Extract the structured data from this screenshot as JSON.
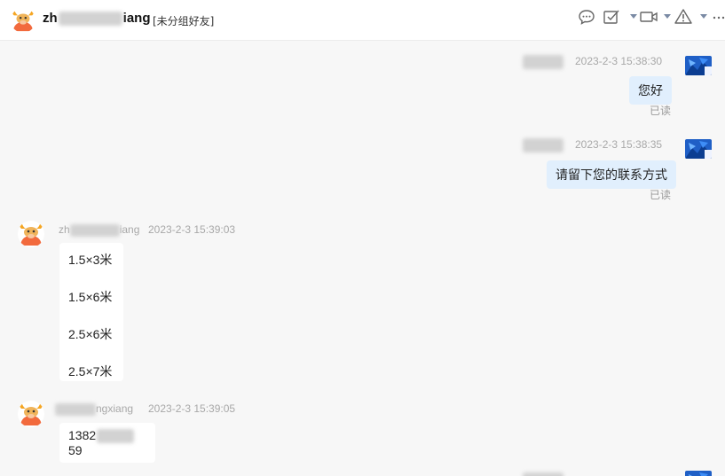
{
  "header": {
    "contact_name_prefix": "zh",
    "contact_name_suffix": "iang",
    "contact_tag": "[未分组好友]"
  },
  "toolbar": {
    "icons": [
      "chat-bubble-icon",
      "task-check-icon",
      "video-camera-icon",
      "warning-icon",
      "more-icon"
    ]
  },
  "messages": [
    {
      "sender_hidden": true,
      "time": "2023-2-3 15:38:30",
      "text": "您好",
      "status": "已读"
    },
    {
      "sender_hidden": true,
      "time": "2023-2-3 15:38:35",
      "text": "请留下您的联系方式",
      "status": "已读"
    },
    {
      "sender_prefix": "zh",
      "sender_suffix": "iang",
      "time": "2023-2-3 15:39:03",
      "lines": [
        "1.5×3米",
        "1.5×6米",
        "2.5×6米",
        "2.5×7米"
      ]
    },
    {
      "sender_suffix": "ngxiang",
      "time": "2023-2-3 15:39:05",
      "text_prefix": "1382",
      "text_suffix": "59"
    }
  ],
  "colors": {
    "my_bubble": "#e1effd",
    "their_bubble": "#ffffff",
    "background": "#f7f7f7",
    "time_text": "#a8a8a8"
  }
}
